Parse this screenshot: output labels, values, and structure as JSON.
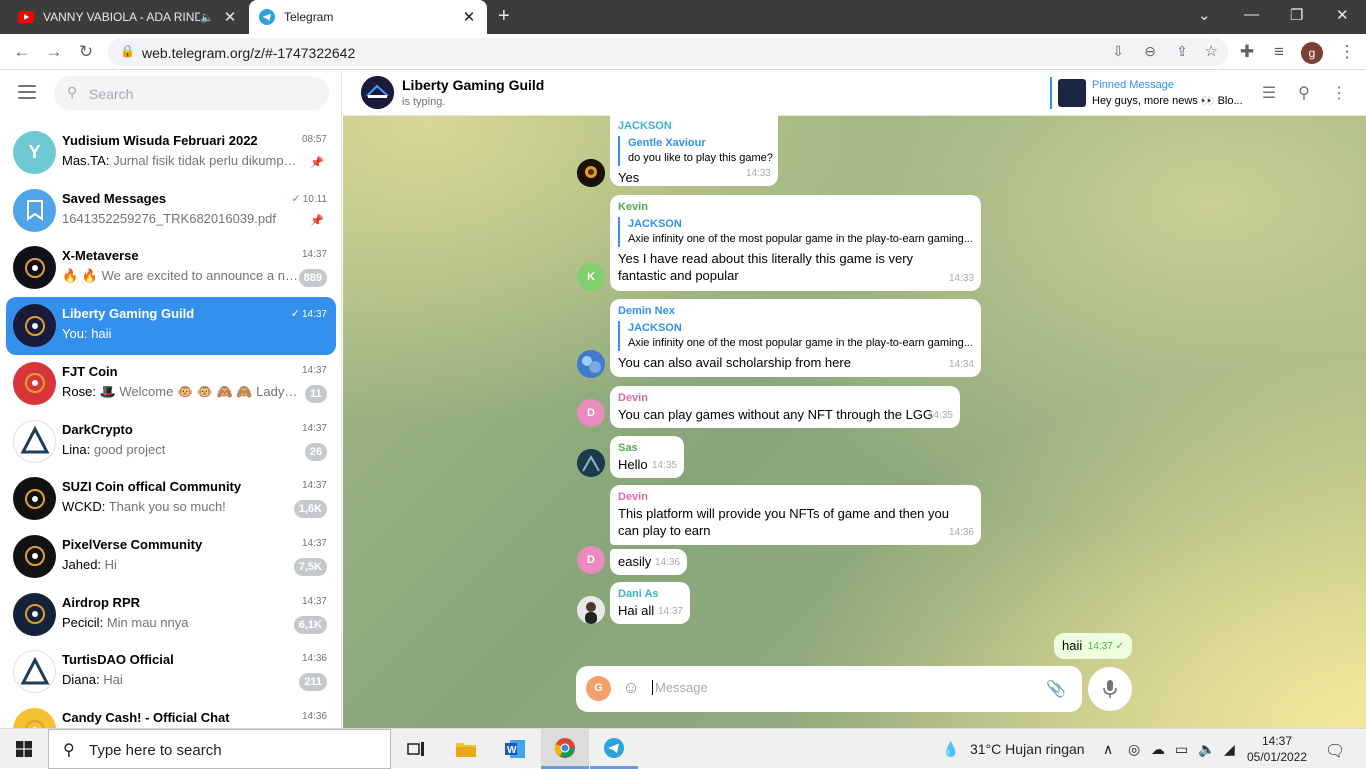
{
  "browser": {
    "tabs": [
      {
        "title": "VANNY VABIOLA - ADA RINDU",
        "active": false
      },
      {
        "title": "Telegram",
        "active": true
      }
    ],
    "url": "web.telegram.org/z/#-1747322642",
    "profile_initial": "g"
  },
  "sidebar": {
    "search_placeholder": "Search",
    "chats": [
      {
        "name": "Yudisium Wisuda Februari 2022",
        "time": "08:57",
        "sender": "Mas.TA:",
        "preview": "Jurnal fisik tidak perlu dikumpulkan",
        "pinned": true,
        "avatar_letter": "Y",
        "avatar_color": "#6fc9d3"
      },
      {
        "name": "Saved Messages",
        "time": "10:11",
        "sender": "",
        "preview": "1641352259276_TRK682016039.pdf",
        "pinned": true,
        "read": true,
        "avatar_color": "#4fa3e8"
      },
      {
        "name": "X-Metaverse",
        "time": "14:37",
        "sender": "",
        "preview": "🔥 🔥 We are excited to announce a new partnership",
        "badge": "889",
        "avatar_color": "#101018"
      },
      {
        "name": "Liberty Gaming Guild",
        "time": "14:37",
        "sender": "You:",
        "preview": "haii",
        "selected": true,
        "read": true,
        "avatar_color": "#1a1a3a"
      },
      {
        "name": "FJT Coin",
        "time": "14:37",
        "sender": "Rose:",
        "preview": "🎩 Welcome 🐵 🐵 🙈 🙈 Lady_Rie...",
        "badge": "11",
        "avatar_color": "#d8353a"
      },
      {
        "name": "DarkCrypto",
        "time": "14:37",
        "sender": "Lina:",
        "preview": "good project",
        "badge": "26",
        "avatar_color": "#ffffff"
      },
      {
        "name": "SUZI Coin offical Community",
        "time": "14:37",
        "sender": "WCKD:",
        "preview": "Thank you so much!",
        "badge": "1,6K",
        "avatar_color": "#111111"
      },
      {
        "name": "PixelVerse Community",
        "time": "14:37",
        "sender": "Jahed:",
        "preview": "Hi",
        "badge": "7,5K",
        "avatar_color": "#121212"
      },
      {
        "name": "Airdrop RPR",
        "time": "14:37",
        "sender": "Pecicil:",
        "preview": "Min mau nnya",
        "badge": "6,1K",
        "avatar_color": "#14233a"
      },
      {
        "name": "TurtisDAO Official",
        "time": "14:36",
        "sender": "Diana:",
        "preview": "Hai",
        "badge": "211",
        "avatar_color": "#ffffff"
      },
      {
        "name": "Candy Cash! - Official Chat",
        "time": "14:36",
        "sender": "",
        "preview": "",
        "avatar_color": "#f2c230"
      }
    ]
  },
  "chat": {
    "title": "Liberty Gaming Guild",
    "status": "is typing.",
    "pinned_title": "Pinned Message",
    "pinned_text": "Hey guys, more news 👀 Blo...",
    "messages": [
      {
        "sender": "JACKSON",
        "sender_color": "#3bb3c4",
        "reply_name": "Gentle Xaviour",
        "reply_text": "do you like to play this game?",
        "text": "Yes",
        "time": "14:33"
      },
      {
        "sender": "Kevin",
        "sender_color": "#4fae4e",
        "reply_name": "JACKSON",
        "reply_text": "Axie infinity one of the most popular game in the play-to-earn gaming...",
        "text": "Yes I have read about this literally this game is very fantastic and popular",
        "time": "14:33",
        "avatar_letter": "K"
      },
      {
        "sender": "Demin Nex",
        "sender_color": "#3390ec",
        "reply_name": "JACKSON",
        "reply_text": "Axie infinity one of the most popular game in the play-to-earn gaming...",
        "text": "You can also avail scholarship from here",
        "time": "14:34"
      },
      {
        "sender": "Devin",
        "sender_color": "#e367a8",
        "text": "You can play games without any NFT through the LGG",
        "time": "14:35",
        "avatar_letter": "D"
      },
      {
        "sender": "Sas",
        "sender_color": "#4fae4e",
        "text": "Hello",
        "time": "14:35"
      },
      {
        "sender": "Devin",
        "sender_color": "#e367a8",
        "text": "This platform will provide you NFTs of game and then you can play to earn",
        "time": "14:36"
      },
      {
        "sender": "",
        "text": "easily",
        "time": "14:36",
        "avatar_letter": "D"
      },
      {
        "sender": "Dani As",
        "sender_color": "#3bb3c4",
        "text": "Hai all",
        "time": "14:37"
      },
      {
        "sender": "",
        "text": "haii",
        "time": "14:37",
        "outgoing": true
      }
    ],
    "composer_placeholder": "Message",
    "composer_avatar": "G"
  },
  "taskbar": {
    "search_placeholder": "Type here to search",
    "weather": "31°C  Hujan ringan",
    "time": "14:37",
    "date": "05/01/2022"
  }
}
